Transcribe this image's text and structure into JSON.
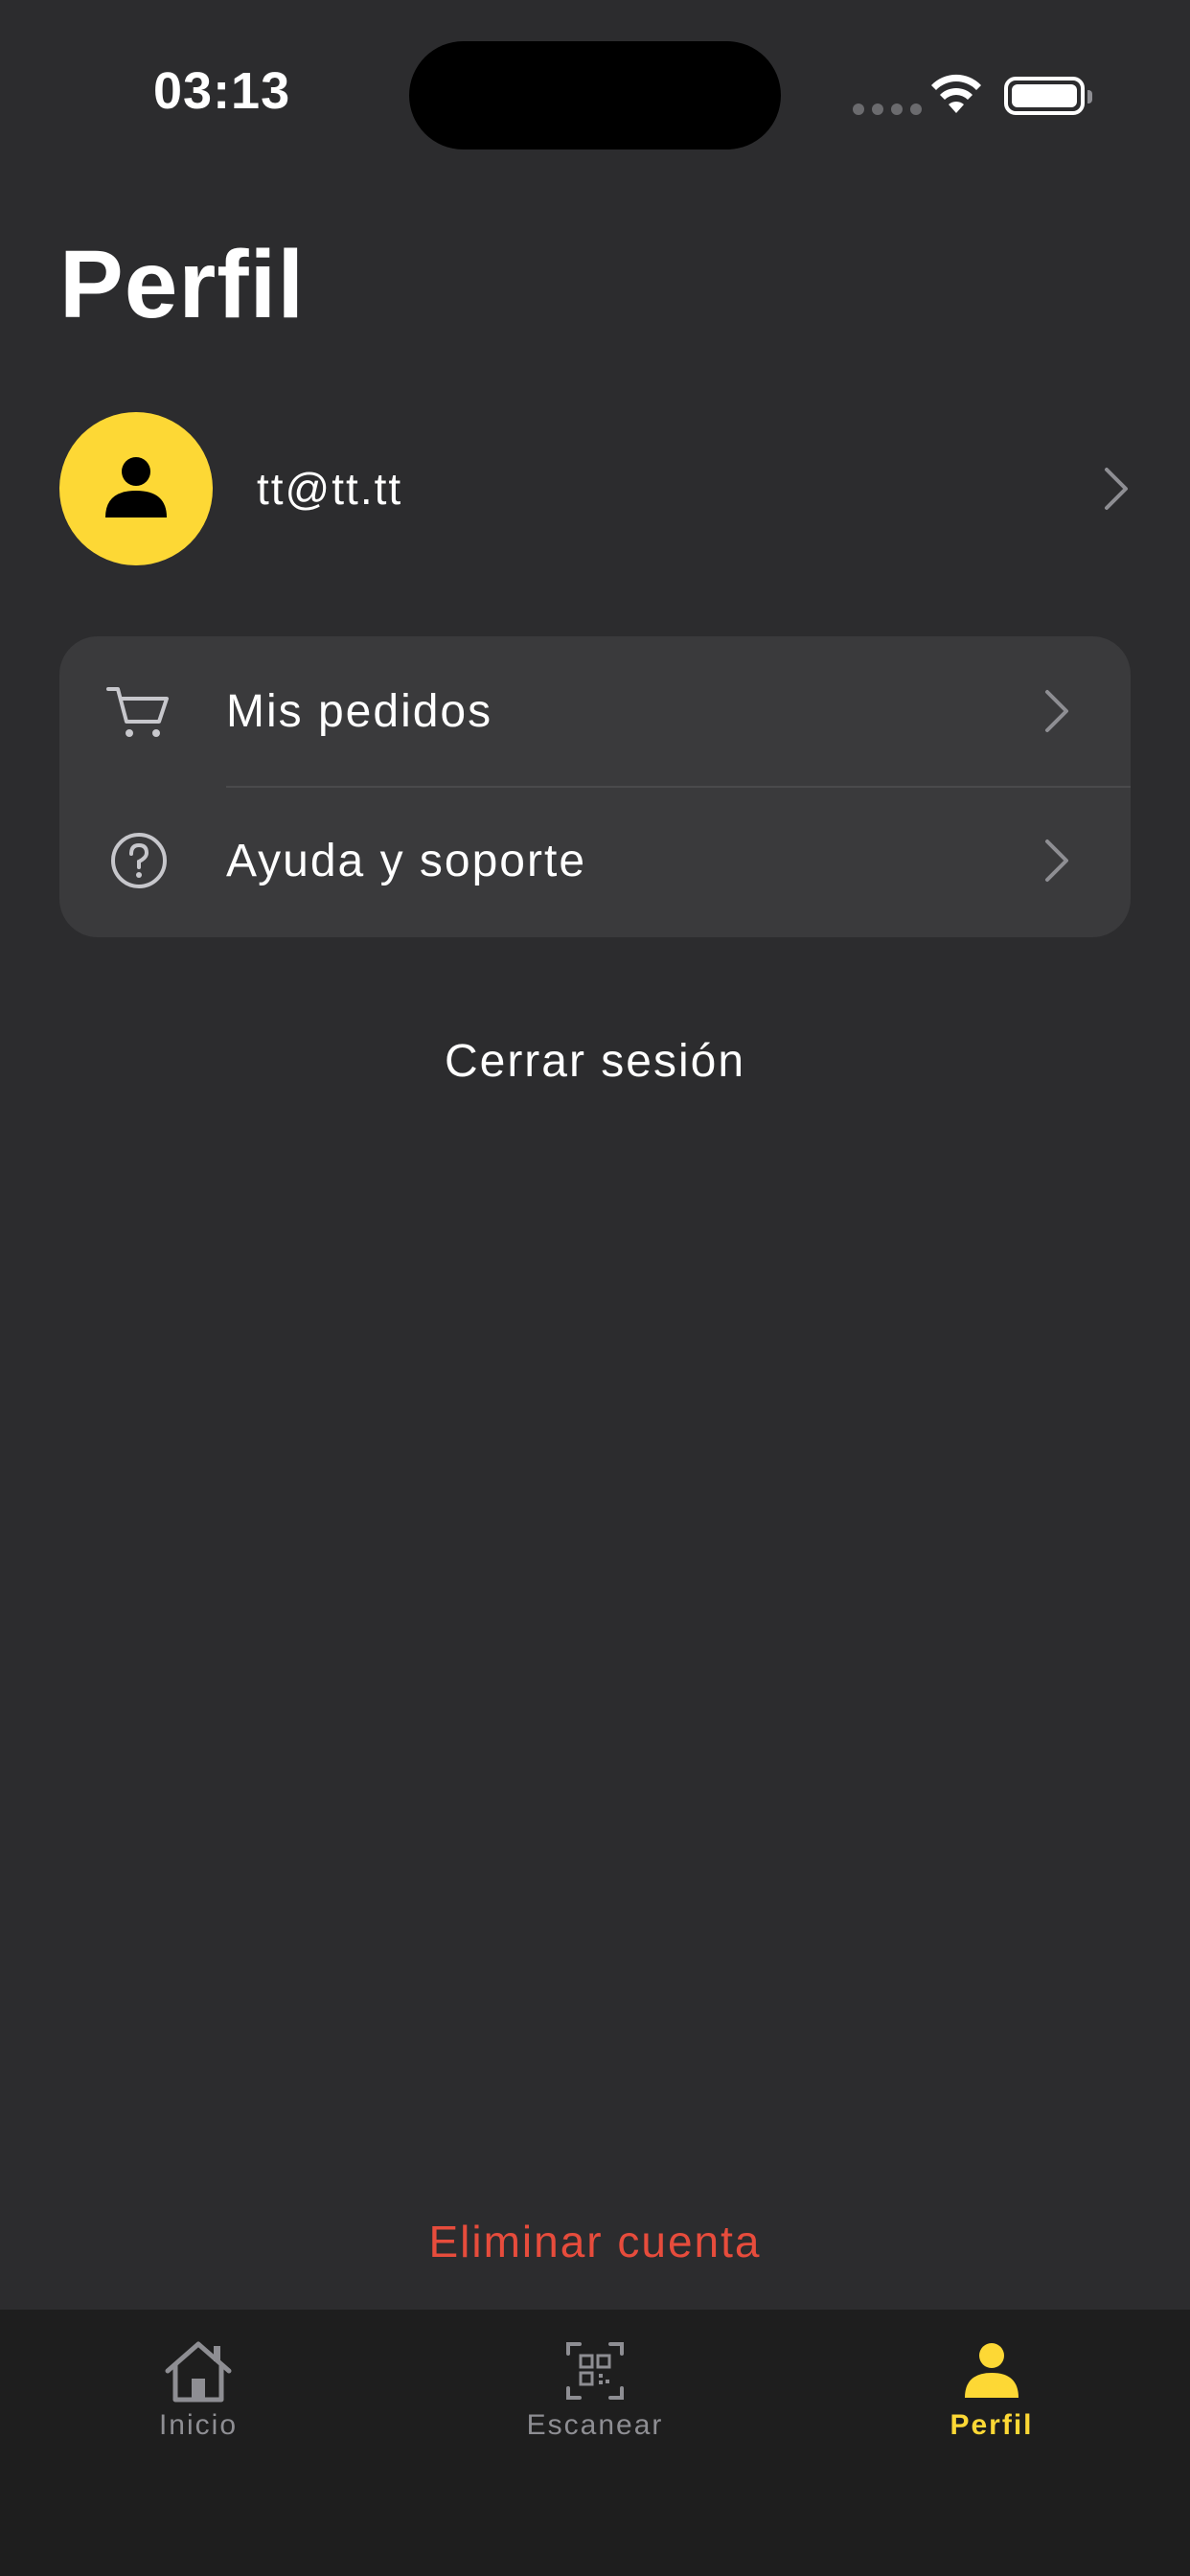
{
  "status_bar": {
    "time": "03:13"
  },
  "page": {
    "title": "Perfil"
  },
  "profile": {
    "email": "tt@tt.tt",
    "avatar_color": "#fdd835"
  },
  "menu": {
    "items": [
      {
        "label": "Mis pedidos",
        "icon": "cart-icon"
      },
      {
        "label": "Ayuda y soporte",
        "icon": "help-circle-icon"
      }
    ]
  },
  "actions": {
    "logout_label": "Cerrar sesión",
    "delete_account_label": "Eliminar cuenta",
    "delete_color": "#e74c3c"
  },
  "tab_bar": {
    "tabs": [
      {
        "label": "Inicio",
        "icon": "home-icon",
        "active": false
      },
      {
        "label": "Escanear",
        "icon": "qr-scan-icon",
        "active": false
      },
      {
        "label": "Perfil",
        "icon": "person-icon",
        "active": true
      }
    ],
    "active_color": "#fdd835"
  }
}
